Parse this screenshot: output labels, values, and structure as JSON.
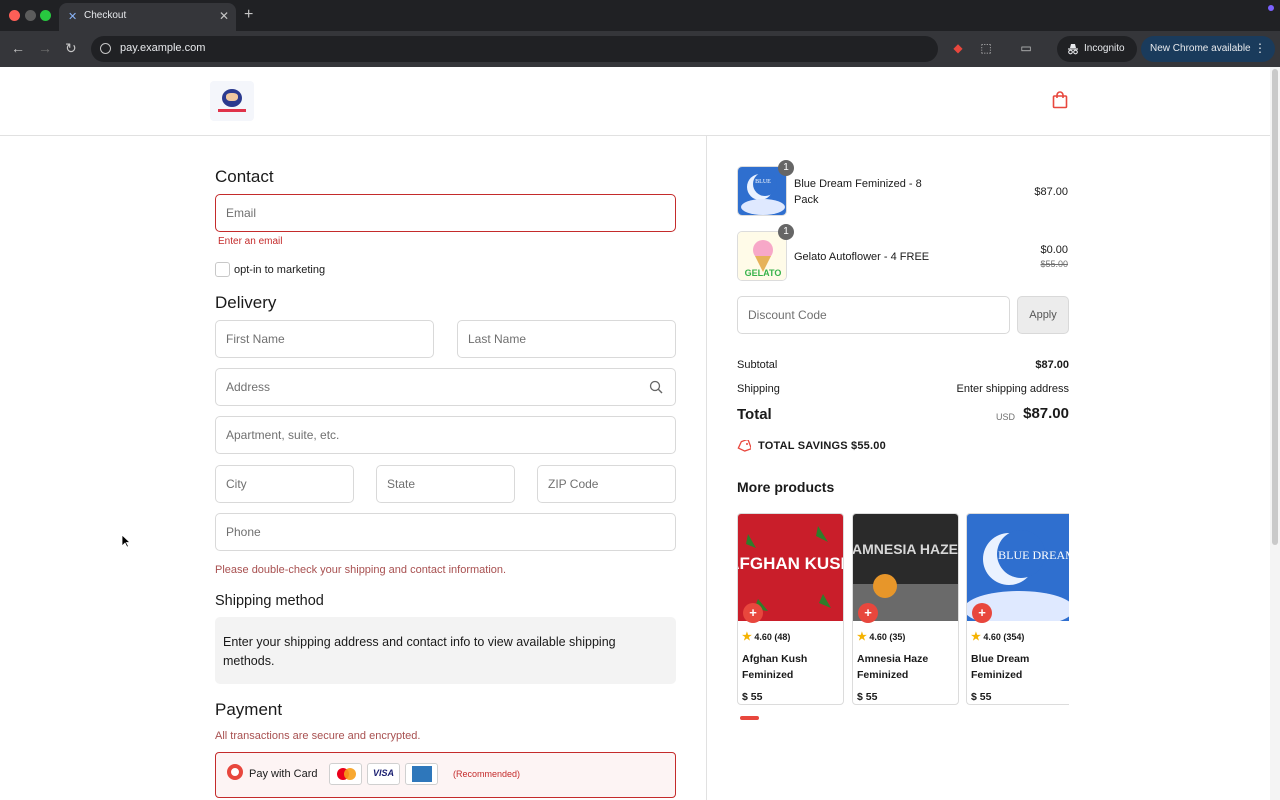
{
  "browser": {
    "tab_title": "Checkout",
    "url": "pay.example.com",
    "incognito_label": "Incognito",
    "update_label": "New Chrome available"
  },
  "contact": {
    "title": "Contact",
    "email_placeholder": "Email",
    "email_error": "Enter an email",
    "marketing_label": "opt-in to marketing"
  },
  "delivery": {
    "title": "Delivery",
    "first_name_placeholder": "First Name",
    "last_name_placeholder": "Last Name",
    "address_placeholder": "Address",
    "apartment_placeholder": "Apartment, suite, etc.",
    "city_placeholder": "City",
    "state_placeholder": "State",
    "zip_placeholder": "ZIP Code",
    "phone_placeholder": "Phone",
    "note": "Please double-check your shipping and contact information."
  },
  "shipping_method": {
    "title": "Shipping method",
    "message": "Enter your shipping address and contact info to view available shipping methods."
  },
  "payment": {
    "title": "Payment",
    "secure_note": "All transactions are secure and encrypted.",
    "option_label": "Pay with Card",
    "card_brands": [
      "mastercard",
      "visa",
      "amex"
    ],
    "visa_text": "VISA",
    "recommended": "(Recommended)"
  },
  "order": {
    "items": [
      {
        "name": "Blue Dream Feminized - 8 Pack",
        "quantity": "1",
        "price": "$87.00",
        "image": "blue-dream"
      },
      {
        "name": "Gelato Autoflower - 4 FREE",
        "quantity": "1",
        "price": "$0.00",
        "original_price": "$55.00",
        "image": "gelato"
      }
    ],
    "discount_placeholder": "Discount Code",
    "apply_label": "Apply",
    "subtotal_label": "Subtotal",
    "subtotal_value": "$87.00",
    "shipping_label": "Shipping",
    "shipping_value": "Enter shipping address",
    "total_label": "Total",
    "total_currency": "USD",
    "total_value": "$87.00",
    "savings_text": "TOTAL SAVINGS  $55.00"
  },
  "more_products": {
    "title": "More products",
    "items": [
      {
        "name": "Afghan Kush Feminized",
        "rating": "4.60 (48)",
        "price": "$ 55",
        "image_text": "AFGHAN KUSH"
      },
      {
        "name": "Amnesia Haze Feminized",
        "rating": "4.60 (35)",
        "price": "$ 55",
        "image_text": "AMNESIA HAZE"
      },
      {
        "name": "Blue Dream Feminized",
        "rating": "4.60 (354)",
        "price": "$ 55",
        "image_text": "BLUE DREAM"
      }
    ]
  },
  "colors": {
    "accent": "#e8473d",
    "error": "#c42b2b",
    "chrome_dark": "#202124"
  },
  "icons": [
    "back-icon",
    "forward-icon",
    "reload-icon",
    "site-info-icon",
    "extensions-icon",
    "cart-icon",
    "search-icon",
    "tag-icon",
    "star-icon",
    "plus-icon"
  ]
}
